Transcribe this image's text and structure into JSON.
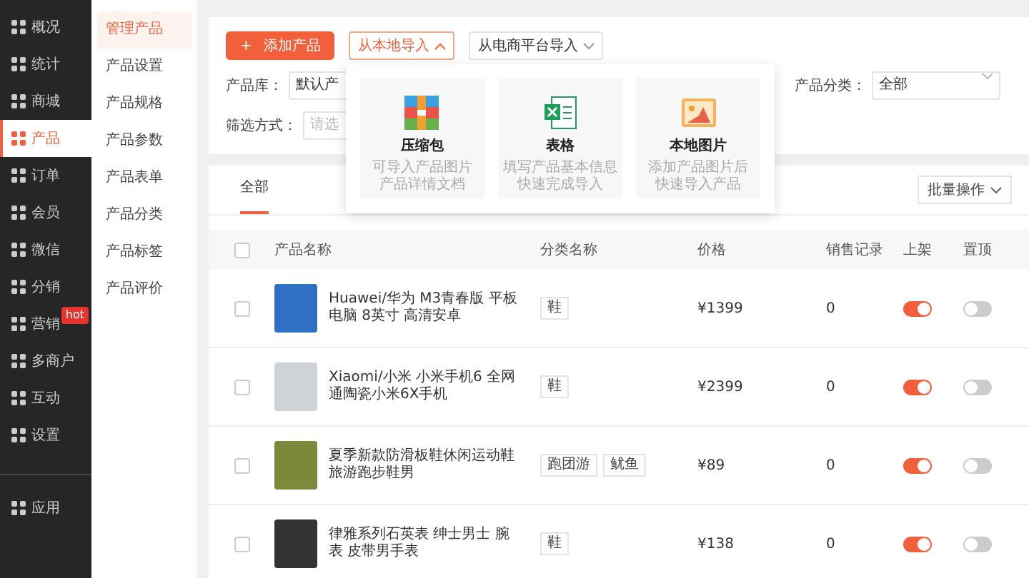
{
  "sidebar": {
    "items": [
      {
        "label": "概况",
        "selected": false
      },
      {
        "label": "统计",
        "selected": false
      },
      {
        "label": "商城",
        "selected": false
      },
      {
        "label": "产品",
        "selected": true
      },
      {
        "label": "订单",
        "selected": false
      },
      {
        "label": "会员",
        "selected": false
      },
      {
        "label": "微信",
        "selected": false
      },
      {
        "label": "分销",
        "selected": false
      },
      {
        "label": "营销",
        "selected": false,
        "badge": "hot"
      },
      {
        "label": "多商户",
        "selected": false
      },
      {
        "label": "互动",
        "selected": false
      },
      {
        "label": "设置",
        "selected": false
      },
      {
        "label": "应用",
        "selected": false
      }
    ]
  },
  "submenu": {
    "items": [
      {
        "label": "管理产品",
        "selected": true
      },
      {
        "label": "产品设置",
        "selected": false
      },
      {
        "label": "产品规格",
        "selected": false
      },
      {
        "label": "产品参数",
        "selected": false
      },
      {
        "label": "产品表单",
        "selected": false
      },
      {
        "label": "产品分类",
        "selected": false
      },
      {
        "label": "产品标签",
        "selected": false
      },
      {
        "label": "产品评价",
        "selected": false
      }
    ]
  },
  "toolbar": {
    "add_button": "添加产品",
    "add_icon": "+",
    "local_import": "从本地导入",
    "platform_import": "从电商平台导入"
  },
  "filters": {
    "library_label": "产品库：",
    "library_value": "默认产",
    "method_label": "筛选方式：",
    "method_placeholder": "请选",
    "category_label": "产品分类：",
    "category_value": "全部"
  },
  "import_menu": [
    {
      "kind": "zip",
      "title": "压缩包",
      "desc": [
        "可导入产品图片",
        "产品详情文档"
      ]
    },
    {
      "kind": "sheet",
      "title": "表格",
      "desc": [
        "填写产品基本信息",
        "快速完成导入"
      ]
    },
    {
      "kind": "image",
      "title": "本地图片",
      "desc": [
        "添加产品图片后",
        "快速导入产品"
      ]
    }
  ],
  "tabs": [
    {
      "label": "全部",
      "selected": true
    }
  ],
  "batch_button": "批量操作",
  "table": {
    "select_all_checked": false,
    "columns": [
      "产品名称",
      "分类名称",
      "价格",
      "销售记录",
      "上架",
      "置顶"
    ],
    "rows": [
      {
        "checked": false,
        "kind": "tablet",
        "name": [
          "Huawei/华为 M3青春版 平板",
          "电脑 8英寸 高清安卓"
        ],
        "tags": [
          "鞋"
        ],
        "price": "¥1399",
        "sales": "0",
        "listed": true,
        "pinned": false
      },
      {
        "checked": false,
        "kind": "phone",
        "name": [
          "Xiaomi/小米 小米手机6 全网",
          "通陶瓷小米6X手机"
        ],
        "tags": [
          "鞋"
        ],
        "price": "¥2399",
        "sales": "0",
        "listed": true,
        "pinned": false
      },
      {
        "checked": false,
        "kind": "shoe",
        "name": [
          "夏季新款防滑板鞋休闲运动鞋",
          "旅游跑步鞋男"
        ],
        "tags": [
          "跑团游",
          "鱿鱼"
        ],
        "price": "¥89",
        "sales": "0",
        "listed": true,
        "pinned": false
      },
      {
        "checked": false,
        "kind": "watch",
        "name": [
          "律雅系列石英表 绅士男士 腕",
          "表 皮带男手表"
        ],
        "tags": [
          "鞋"
        ],
        "price": "¥138",
        "sales": "0",
        "listed": true,
        "pinned": false
      }
    ]
  }
}
